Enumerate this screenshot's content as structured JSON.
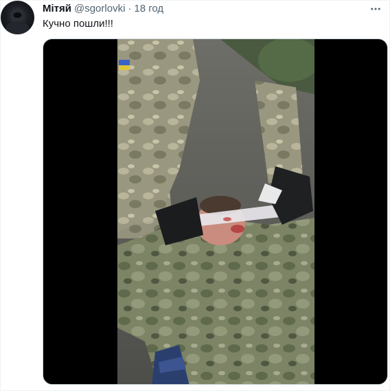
{
  "tweet": {
    "author_name": "Мітяй",
    "author_handle": "@sgorlovki",
    "separator": "·",
    "timestamp": "18 год",
    "text": "Кучно пошли!!!"
  },
  "icons": {
    "more": "more-horizontal-icon",
    "avatar": "avatar-image"
  },
  "media": {
    "type": "video-still",
    "letterbox_color": "#000000"
  },
  "colors": {
    "text_primary": "#0f1419",
    "text_secondary": "#536471",
    "border": "#cfd9de"
  }
}
